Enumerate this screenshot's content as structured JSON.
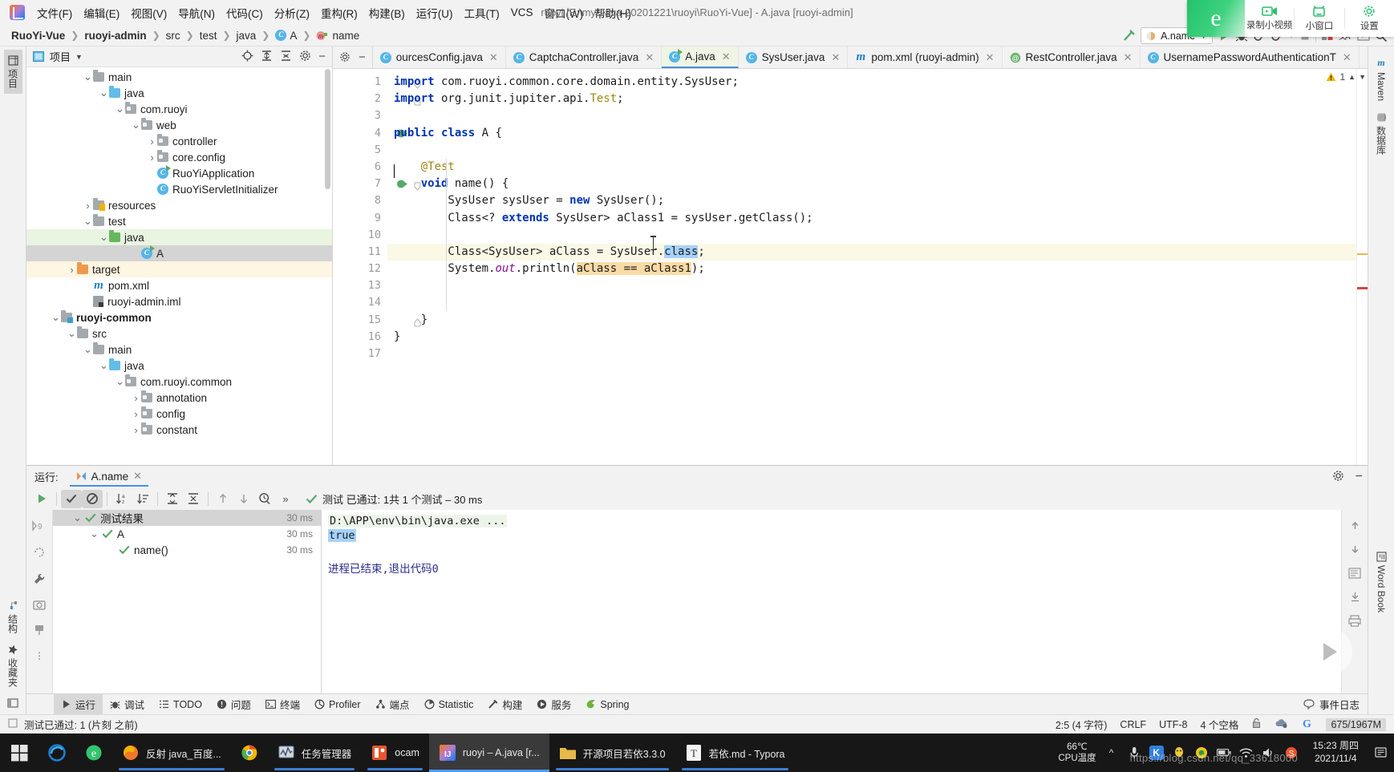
{
  "window": {
    "title": "ruoyi [E:\\my-Java-20201221\\ruoyi\\RuoYi-Vue] - A.java [ruoyi-admin]"
  },
  "menubar": {
    "items": [
      {
        "label": "文件(F)"
      },
      {
        "label": "编辑(E)"
      },
      {
        "label": "视图(V)"
      },
      {
        "label": "导航(N)"
      },
      {
        "label": "代码(C)"
      },
      {
        "label": "分析(Z)"
      },
      {
        "label": "重构(R)"
      },
      {
        "label": "构建(B)"
      },
      {
        "label": "运行(U)"
      },
      {
        "label": "工具(T)"
      },
      {
        "label": "VCS"
      },
      {
        "label": "窗口(W)"
      },
      {
        "label": "帮助(H)"
      }
    ]
  },
  "breadcrumb": {
    "items": [
      "RuoYi-Vue",
      "ruoyi-admin",
      "src",
      "test",
      "java",
      "A",
      "name"
    ],
    "run_config": "A.name"
  },
  "recorder": {
    "logo": "e",
    "buttons": [
      "录制小视频",
      "小窗口",
      "设置"
    ]
  },
  "project": {
    "title": "项目",
    "tree": [
      {
        "label": "main",
        "indent": 3,
        "arrow": "v",
        "icon": "folder-gray"
      },
      {
        "label": "java",
        "indent": 4,
        "arrow": "v",
        "icon": "folder-blue"
      },
      {
        "label": "com.ruoyi",
        "indent": 5,
        "arrow": "v",
        "icon": "package"
      },
      {
        "label": "web",
        "indent": 6,
        "arrow": "v",
        "icon": "package"
      },
      {
        "label": "controller",
        "indent": 7,
        "arrow": ">",
        "icon": "package"
      },
      {
        "label": "core.config",
        "indent": 7,
        "arrow": ">",
        "icon": "package"
      },
      {
        "label": "RuoYiApplication",
        "indent": 7,
        "arrow": "",
        "icon": "class-run"
      },
      {
        "label": "RuoYiServletInitializer",
        "indent": 7,
        "arrow": "",
        "icon": "class"
      },
      {
        "label": "resources",
        "indent": 3,
        "arrow": ">",
        "icon": "resources"
      },
      {
        "label": "test",
        "indent": 3,
        "arrow": "v",
        "icon": "folder-gray"
      },
      {
        "label": "java",
        "indent": 4,
        "arrow": "v",
        "icon": "folder-green",
        "state": "green"
      },
      {
        "label": "A",
        "indent": 6,
        "arrow": "",
        "icon": "class-run",
        "state": "selected"
      },
      {
        "label": "target",
        "indent": 2,
        "arrow": ">",
        "icon": "folder-orange",
        "state": "yellowish"
      },
      {
        "label": "pom.xml",
        "indent": 3,
        "arrow": "",
        "icon": "maven"
      },
      {
        "label": "ruoyi-admin.iml",
        "indent": 3,
        "arrow": "",
        "icon": "iml"
      },
      {
        "label": "ruoyi-common",
        "indent": 1,
        "arrow": "v",
        "icon": "module",
        "bold": true
      },
      {
        "label": "src",
        "indent": 2,
        "arrow": "v",
        "icon": "folder-gray"
      },
      {
        "label": "main",
        "indent": 3,
        "arrow": "v",
        "icon": "folder-gray"
      },
      {
        "label": "java",
        "indent": 4,
        "arrow": "v",
        "icon": "folder-blue"
      },
      {
        "label": "com.ruoyi.common",
        "indent": 5,
        "arrow": "v",
        "icon": "package"
      },
      {
        "label": "annotation",
        "indent": 6,
        "arrow": ">",
        "icon": "package"
      },
      {
        "label": "config",
        "indent": 6,
        "arrow": ">",
        "icon": "package"
      },
      {
        "label": "constant",
        "indent": 6,
        "arrow": ">",
        "icon": "package"
      }
    ]
  },
  "editor": {
    "tabs": [
      {
        "label": "ourcesConfig.java",
        "icon": "class",
        "active": false
      },
      {
        "label": "CaptchaController.java",
        "icon": "class",
        "active": false
      },
      {
        "label": "A.java",
        "icon": "class-run",
        "active": true
      },
      {
        "label": "SysUser.java",
        "icon": "class",
        "active": false
      },
      {
        "label": "pom.xml (ruoyi-admin)",
        "icon": "maven",
        "active": false
      },
      {
        "label": "RestController.java",
        "icon": "annotation",
        "active": false
      },
      {
        "label": "UsernamePasswordAuthenticationT",
        "icon": "class",
        "active": false
      }
    ],
    "warning_count": "1",
    "lines": [
      {
        "n": 1,
        "text": "import com.ruoyi.common.core.domain.entity.SysUser;"
      },
      {
        "n": 2,
        "text": "import org.junit.jupiter.api.Test;"
      },
      {
        "n": 3,
        "text": ""
      },
      {
        "n": 4,
        "text": "public class A {"
      },
      {
        "n": 5,
        "text": ""
      },
      {
        "n": 6,
        "text": "    @Test"
      },
      {
        "n": 7,
        "text": "    void name() {"
      },
      {
        "n": 8,
        "text": "        SysUser sysUser = new SysUser();"
      },
      {
        "n": 9,
        "text": "        Class<? extends SysUser> aClass1 = sysUser.getClass();"
      },
      {
        "n": 10,
        "text": ""
      },
      {
        "n": 11,
        "text": "        Class<SysUser> aClass = SysUser.class;"
      },
      {
        "n": 12,
        "text": "        System.out.println(aClass == aClass1);"
      },
      {
        "n": 13,
        "text": ""
      },
      {
        "n": 14,
        "text": ""
      },
      {
        "n": 15,
        "text": "    }"
      },
      {
        "n": 16,
        "text": "}"
      },
      {
        "n": 17,
        "text": ""
      }
    ]
  },
  "right_stripe": {
    "tabs": [
      "Maven",
      "数据库",
      "Word Book"
    ]
  },
  "left_stripe": {
    "tabs": [
      "项目",
      "结构",
      "收藏夹"
    ]
  },
  "run_panel": {
    "label": "运行:",
    "tab": "A.name",
    "status": "测试 已通过: 1共 1 个测试 – 30 ms",
    "tree": [
      {
        "label": "测试结果",
        "time": "30 ms",
        "indent": 0,
        "arrow": "v",
        "selected": true
      },
      {
        "label": "A",
        "time": "30 ms",
        "indent": 1,
        "arrow": "v",
        "selected": false
      },
      {
        "label": "name()",
        "time": "30 ms",
        "indent": 2,
        "arrow": "",
        "selected": false
      }
    ],
    "console": {
      "command": "D:\\APP\\env\\bin\\java.exe ...",
      "output": "true",
      "exit": "进程已结束,退出代码0"
    }
  },
  "tool_windows": {
    "items": [
      {
        "label": "运行",
        "icon": "play-icon",
        "active": true
      },
      {
        "label": "调试",
        "icon": "bug-icon",
        "active": false
      },
      {
        "label": "TODO",
        "icon": "list-icon",
        "active": false
      },
      {
        "label": "问题",
        "icon": "warning-icon",
        "active": false
      },
      {
        "label": "终端",
        "icon": "terminal-icon",
        "active": false
      },
      {
        "label": "Profiler",
        "icon": "profiler-icon",
        "active": false
      },
      {
        "label": "端点",
        "icon": "endpoints-icon",
        "active": false
      },
      {
        "label": "Statistic",
        "icon": "stats-icon",
        "active": false
      },
      {
        "label": "构建",
        "icon": "hammer-icon",
        "active": false
      },
      {
        "label": "服务",
        "icon": "services-icon",
        "active": false
      },
      {
        "label": "Spring",
        "icon": "spring-icon",
        "active": false
      }
    ],
    "event_log": "事件日志"
  },
  "status_bar": {
    "message": "测试已通过: 1 (片刻 之前)",
    "caret": "2:5 (4 字符)",
    "line_sep": "CRLF",
    "encoding": "UTF-8",
    "indent": "4 个空格",
    "memory": "675/1967M"
  },
  "taskbar": {
    "apps": [
      {
        "label": "",
        "icon": "edge-icon",
        "color": "#1a7fd4",
        "state": ""
      },
      {
        "label": "",
        "icon": "ie360-icon",
        "color": "#32c46e",
        "state": ""
      },
      {
        "label": "反射 java_百度...",
        "icon": "firefox-icon",
        "color": "#f0772b",
        "state": "running"
      },
      {
        "label": "",
        "icon": "chrome-icon",
        "color": "#f5b400",
        "state": ""
      },
      {
        "label": "任务管理器",
        "icon": "taskmgr-icon",
        "color": "#7a8fa6",
        "state": "running"
      },
      {
        "label": "ocam",
        "icon": "ocam-icon",
        "color": "#e8552d",
        "state": "running"
      },
      {
        "label": "ruoyi – A.java [r...",
        "icon": "idea-icon",
        "color": "#c4418a",
        "state": "active"
      },
      {
        "label": "开源项目若依3.3.0",
        "icon": "folder-icon",
        "color": "#e8b84b",
        "state": "running"
      },
      {
        "label": "若依.md - Typora",
        "icon": "typora-icon",
        "color": "#d8d8d8",
        "state": "running"
      }
    ],
    "cpu_temp": "66℃",
    "cpu_label": "CPU温度",
    "clock_time": "15:23 周四",
    "clock_date": "2021/11/4",
    "watermark": "https://blog.csdn.net/qq_33618000"
  }
}
